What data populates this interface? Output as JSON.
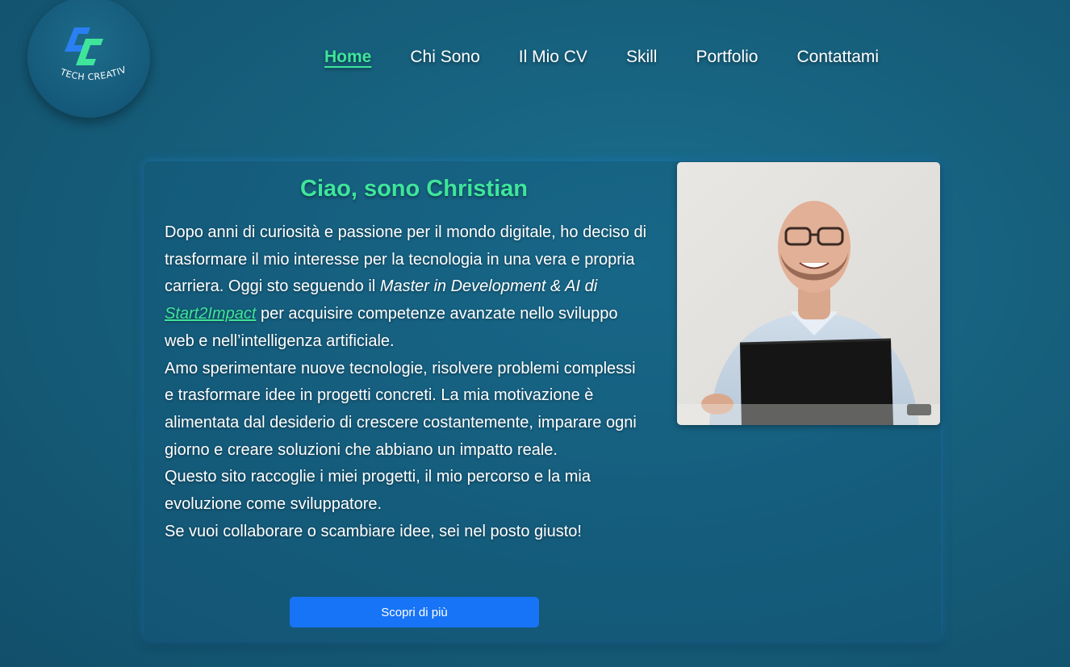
{
  "logo": {
    "monogram": "CC",
    "tagline": "TECH CREATIVE"
  },
  "nav": [
    {
      "label": "Home",
      "active": true
    },
    {
      "label": "Chi Sono"
    },
    {
      "label": "Il Mio CV"
    },
    {
      "label": "Skill"
    },
    {
      "label": "Portfolio"
    },
    {
      "label": "Contattami"
    }
  ],
  "hero": {
    "greeting": "Ciao, sono Christian",
    "p1_before": "Dopo anni di curiosità e passione per il mondo digitale, ho deciso di trasformare il mio interesse per la tecnologia in una vera e propria carriera. Oggi sto seguendo il ",
    "p1_course": "Master in Development & AI di ",
    "p1_link": "Start2Impact",
    "p1_after": " per acquisire competenze avanzate nello sviluppo web e nell’intelligenza artificiale.",
    "p2": "Amo sperimentare nuove tecnologie, risolvere problemi complessi e trasformare idee in progetti concreti. La mia motivazione è alimentata dal desiderio di crescere costantemente, imparare ogni giorno e creare soluzioni che abbiano un impatto reale.",
    "p3": "Questo sito raccoglie i miei progetti, il mio percorso e la mia evoluzione come sviluppatore.",
    "p4": "Se vuoi collaborare o scambiare idee, sei nel posto giusto!",
    "button": "Scopri di più"
  },
  "colors": {
    "accent": "#3ee59b",
    "button": "#1774f6",
    "background": "#16607d"
  }
}
